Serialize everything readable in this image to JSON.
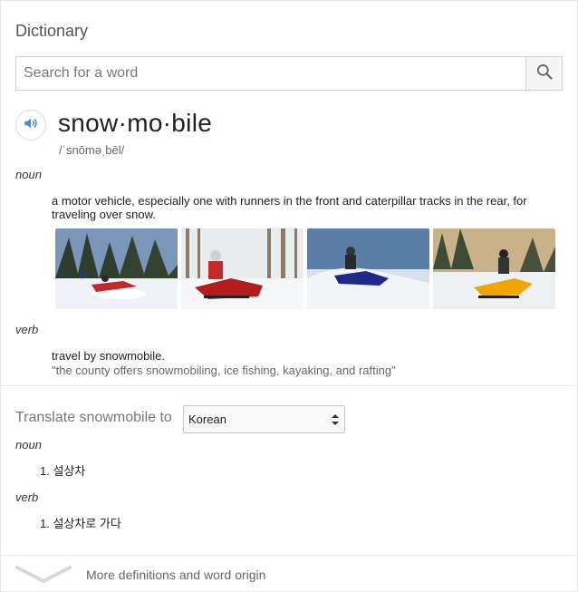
{
  "header": {
    "title": "Dictionary"
  },
  "search": {
    "placeholder": "Search for a word",
    "value": ""
  },
  "entry": {
    "word": "snow·mo·bile",
    "phonetic": "/ˈsnōməˌbēl/",
    "noun": {
      "pos": "noun",
      "definition": "a motor vehicle, especially one with runners in the front and caterpillar tracks in the rear, for traveling over snow."
    },
    "verb": {
      "pos": "verb",
      "definition": "travel by snowmobile.",
      "example": "\"the county offers snowmobiling, ice fishing, kayaking, and rafting\""
    }
  },
  "translate": {
    "label": "Translate snowmobile to",
    "language": "Korean",
    "noun_pos": "noun",
    "noun_items": [
      "1. 설상차"
    ],
    "verb_pos": "verb",
    "verb_items": [
      "1. 설상차로 가다"
    ]
  },
  "footer": {
    "more_label": "More definitions and word origin"
  },
  "colors": {
    "accent": "#4285f4",
    "sled_red": "#c62828",
    "sled_yellow": "#f0a500",
    "sled_blue": "#1e2a8a"
  }
}
